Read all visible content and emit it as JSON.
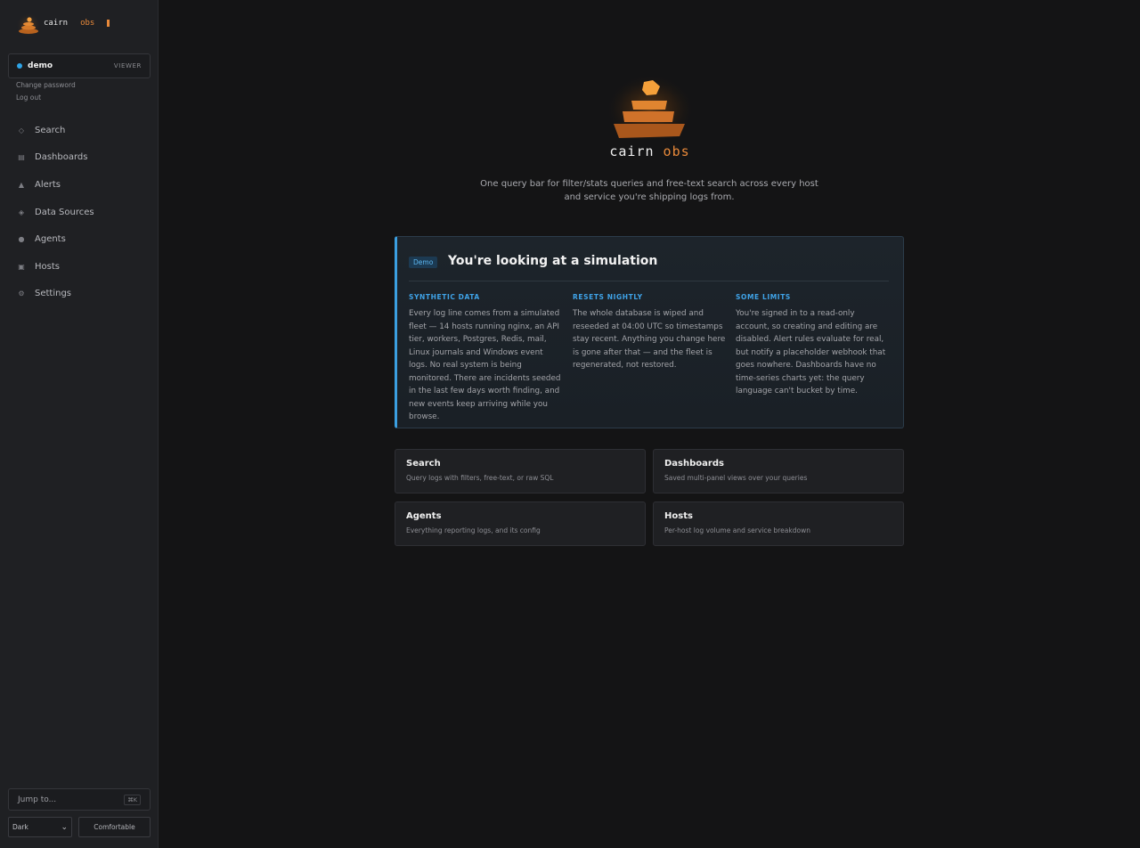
{
  "brand": {
    "name": "cairn",
    "accent": "obs"
  },
  "user": {
    "name": "demo",
    "role": "VIEWER",
    "change_password": "Change password",
    "log_out": "Log out"
  },
  "nav": {
    "items": [
      {
        "label": "Search",
        "icon": "diamond-outline-icon"
      },
      {
        "label": "Dashboards",
        "icon": "dashboard-grid-icon"
      },
      {
        "label": "Alerts",
        "icon": "triangle-alert-icon"
      },
      {
        "label": "Data Sources",
        "icon": "diamond-filled-icon"
      },
      {
        "label": "Agents",
        "icon": "dot-agent-icon"
      },
      {
        "label": "Hosts",
        "icon": "square-host-icon"
      },
      {
        "label": "Settings",
        "icon": "gear-icon"
      }
    ]
  },
  "footer": {
    "jump_label": "Jump to...",
    "jump_shortcut": "⌘K",
    "theme_value": "Dark",
    "density_label": "Comfortable"
  },
  "hero": {
    "title": "cairn",
    "accent": "obs",
    "tagline": "One query bar for filter/stats queries and free-text search across every host and service you're shipping logs from."
  },
  "demo": {
    "badge": "Demo",
    "title": "You're looking at a simulation",
    "columns": [
      {
        "heading": "SYNTHETIC DATA",
        "body": "Every log line comes from a simulated fleet — 14 hosts running nginx, an API tier, workers, Postgres, Redis, mail, Linux journals and Windows event logs. No real system is being monitored. There are incidents seeded in the last few days worth finding, and new events keep arriving while you browse."
      },
      {
        "heading": "RESETS NIGHTLY",
        "body": "The whole database is wiped and reseeded at 04:00 UTC so timestamps stay recent. Anything you change here is gone after that — and the fleet is regenerated, not restored."
      },
      {
        "heading": "SOME LIMITS",
        "body": "You're signed in to a read-only account, so creating and editing are disabled. Alert rules evaluate for real, but notify a placeholder webhook that goes nowhere. Dashboards have no time-series charts yet: the query language can't bucket by time."
      }
    ]
  },
  "tiles": [
    {
      "title": "Search",
      "desc": "Query logs with filters, free-text, or raw SQL"
    },
    {
      "title": "Dashboards",
      "desc": "Saved multi-panel views over your queries"
    },
    {
      "title": "Agents",
      "desc": "Everything reporting logs, and its config"
    },
    {
      "title": "Hosts",
      "desc": "Per-host log volume and service breakdown"
    }
  ],
  "colors": {
    "accent_orange": "#e8893a",
    "accent_blue": "#3b9fe0",
    "background": "#141415",
    "sidebar": "#1f2023"
  }
}
